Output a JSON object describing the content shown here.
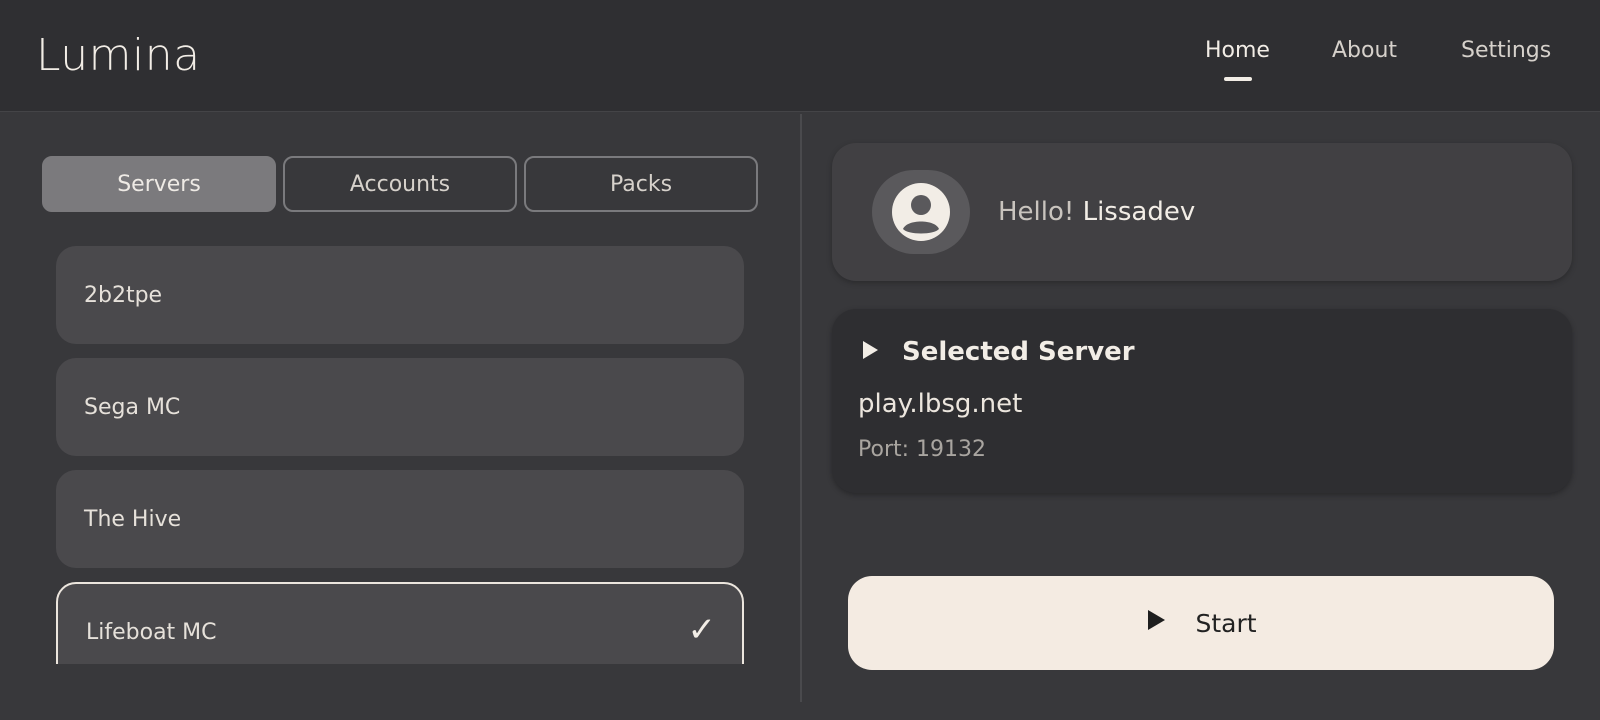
{
  "app": {
    "title": "Lumina"
  },
  "nav": {
    "items": [
      "Home",
      "About",
      "Settings"
    ],
    "active": "Home"
  },
  "tabs": {
    "items": [
      "Servers",
      "Accounts",
      "Packs"
    ],
    "active": "Servers"
  },
  "servers": {
    "items": [
      {
        "name": "2b2tpe",
        "selected": false
      },
      {
        "name": "Sega MC",
        "selected": false
      },
      {
        "name": "The Hive",
        "selected": false
      },
      {
        "name": "Lifeboat MC",
        "selected": true
      }
    ],
    "check_glyph": "✓"
  },
  "greeting": {
    "hello": "Hello!",
    "username": "Lissadev",
    "icon": "user-avatar-icon"
  },
  "selected_server": {
    "title": "Selected Server",
    "host": "play.lbsg.net",
    "port_text": "Port: 19132",
    "icon": "play-icon"
  },
  "start": {
    "label": "Start",
    "icon": "play-icon"
  },
  "colors": {
    "background": "#38383b",
    "topbar": "#2f2f32",
    "card": "#414043",
    "card_dark": "#2e2e31",
    "list_item": "#4a494c",
    "active_tab": "#7b7a7d",
    "accent": "#f4ebe2"
  }
}
